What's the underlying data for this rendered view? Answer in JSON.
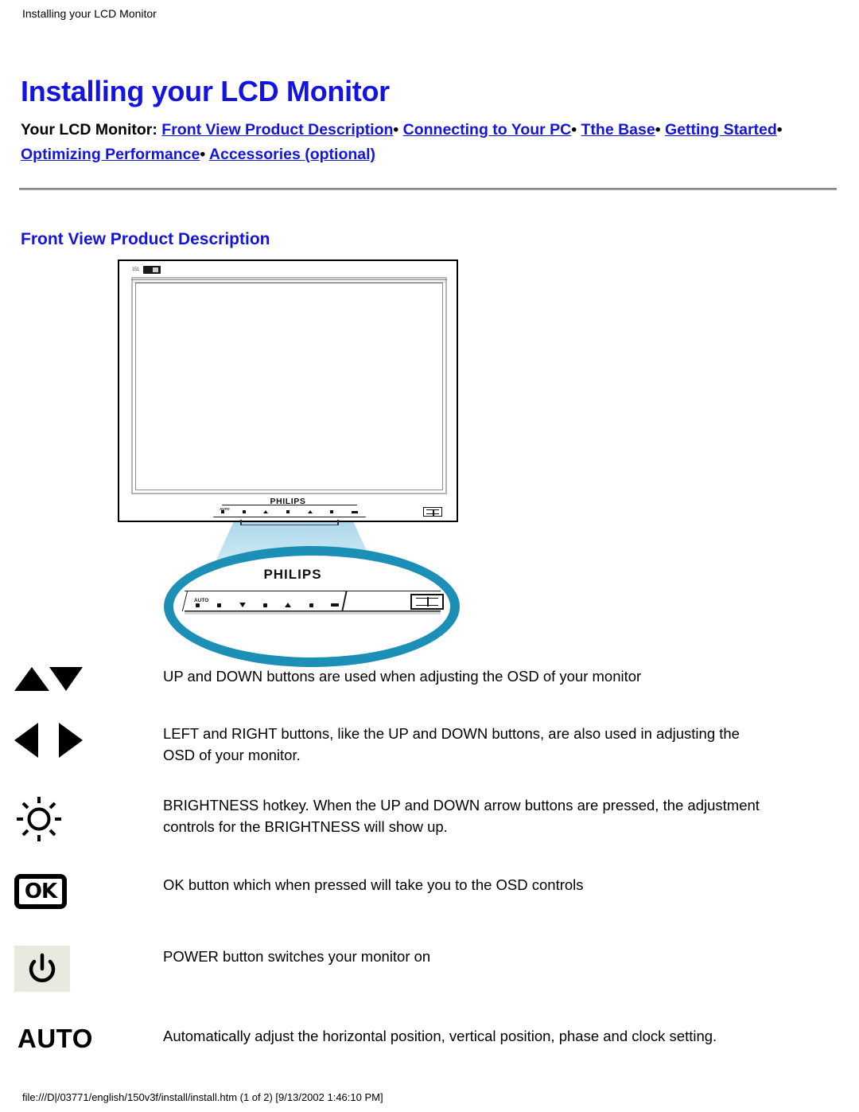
{
  "breadcrumb": "Installing your LCD Monitor",
  "page_title": "Installing your LCD Monitor",
  "nav": {
    "lead_label": "Your LCD Monitor",
    "colon": ":",
    "separator": "•",
    "links": [
      "Front View Product Description",
      "Connecting to Your PC",
      "Tthe Base",
      "Getting Started",
      "Optimizing Performance",
      "Accessories (optional)"
    ]
  },
  "section": {
    "heading": "Front View Product Description"
  },
  "figure": {
    "brand": "PHILIPS",
    "magnified_brand": "PHILIPS",
    "auto_label": "AUTO",
    "ring_color": "#1b8fb5",
    "beam_color": "#b7deee"
  },
  "descriptions": [
    {
      "icon": "up-down-arrows-icon",
      "icon_label": "",
      "text": "UP and DOWN buttons are used when adjusting the OSD of your monitor"
    },
    {
      "icon": "left-right-arrows-icon",
      "icon_label": "",
      "text": "LEFT and RIGHT buttons, like the UP and DOWN buttons, are also used in adjusting the OSD of your monitor."
    },
    {
      "icon": "brightness-sun-icon",
      "icon_label": "",
      "text": "BRIGHTNESS hotkey. When the UP and DOWN arrow buttons are pressed, the adjustment controls for the BRIGHTNESS will show up."
    },
    {
      "icon": "ok-button-icon",
      "icon_label": "OK",
      "text": "OK button which when pressed will take you to the OSD controls"
    },
    {
      "icon": "power-button-icon",
      "icon_label": "",
      "text": "POWER button switches your monitor on"
    },
    {
      "icon": "auto-button-icon",
      "icon_label": "AUTO",
      "text": "Automatically adjust the horizontal position, vertical position, phase and clock setting."
    }
  ],
  "footer": "file:///D|/03771/english/150v3f/install/install.htm (1 of 2) [9/13/2002 1:46:10 PM]",
  "colors": {
    "heading_blue": "#1414e0",
    "link_blue": "#1414e0",
    "rule_gray": "#9a9a9a"
  }
}
